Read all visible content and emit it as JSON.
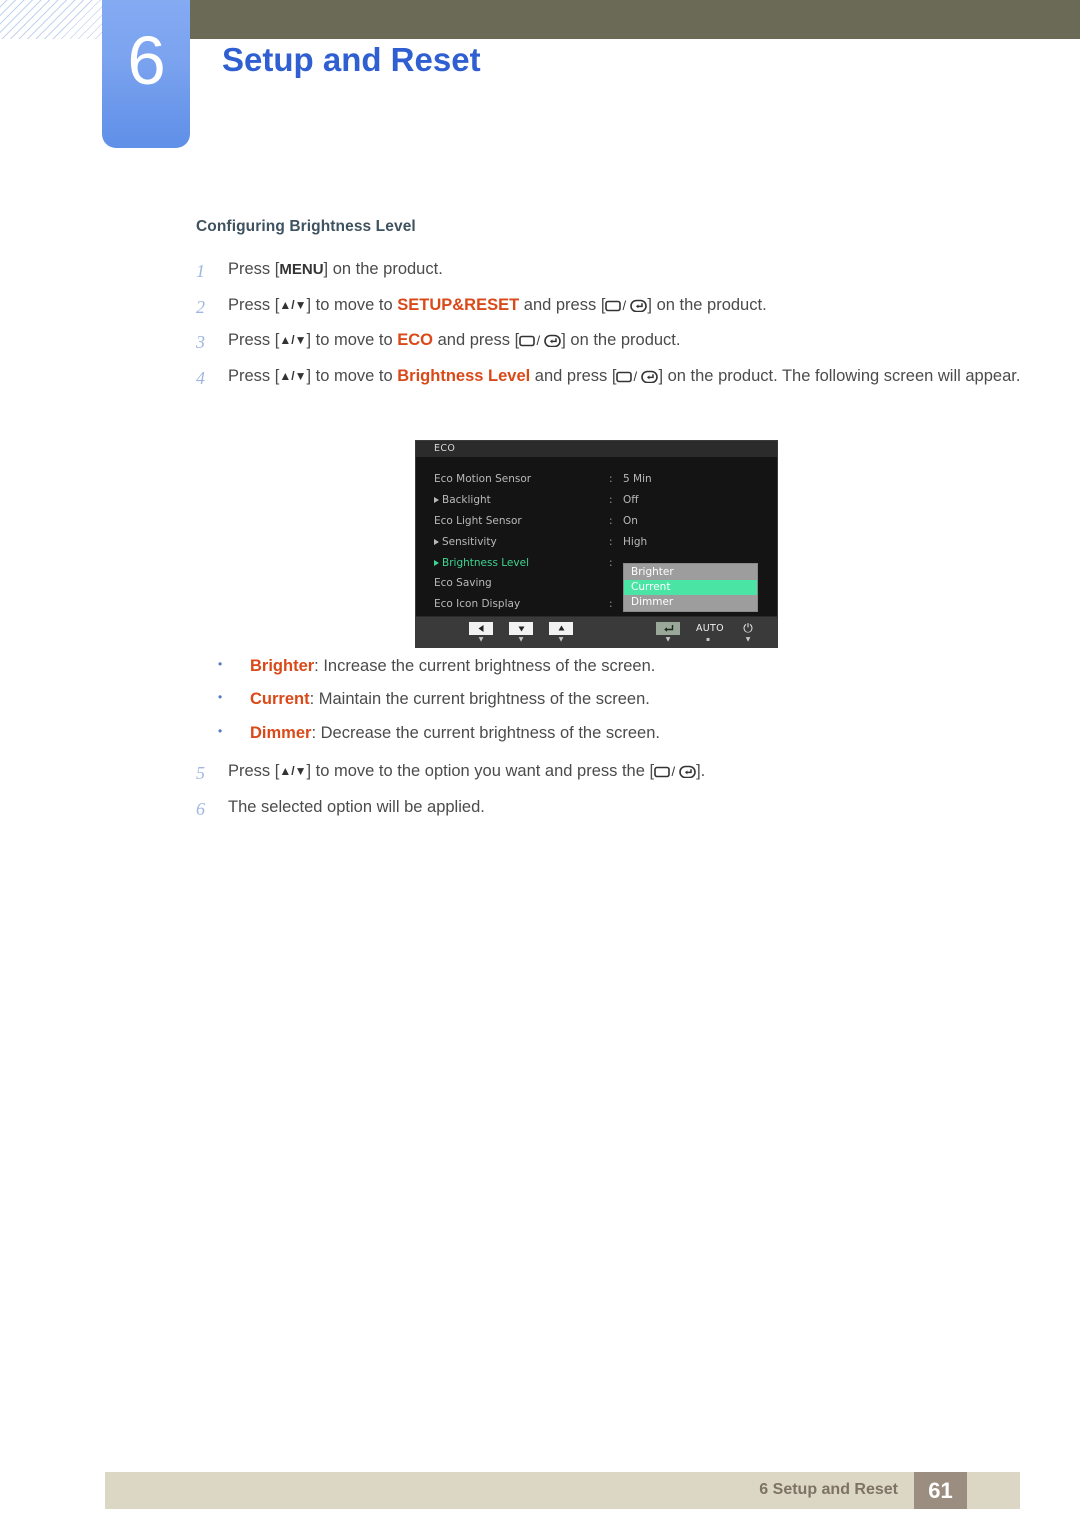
{
  "header": {
    "chapter_number": "6",
    "chapter_title": "Setup and Reset",
    "accent_color": "#2f5fd0",
    "badge_color": "#7ba3ef",
    "bar_color": "#6b6a56"
  },
  "section": {
    "heading": "Configuring Brightness Level"
  },
  "steps": [
    {
      "num": "1",
      "parts": [
        {
          "t": "text",
          "v": "Press ["
        },
        {
          "t": "menukey",
          "v": "MENU"
        },
        {
          "t": "text",
          "v": "] on the product."
        }
      ]
    },
    {
      "num": "2",
      "parts": [
        {
          "t": "text",
          "v": "Press ["
        },
        {
          "t": "arrows",
          "v": "▲/▼"
        },
        {
          "t": "text",
          "v": "] to move to "
        },
        {
          "t": "kw",
          "v": "SETUP&RESET"
        },
        {
          "t": "text",
          "v": " and press ["
        },
        {
          "t": "backenter",
          "v": "back/enter-key-icon"
        },
        {
          "t": "text",
          "v": "] on the product."
        }
      ]
    },
    {
      "num": "3",
      "parts": [
        {
          "t": "text",
          "v": "Press ["
        },
        {
          "t": "arrows",
          "v": "▲/▼"
        },
        {
          "t": "text",
          "v": "] to move to "
        },
        {
          "t": "kw",
          "v": "ECO"
        },
        {
          "t": "text",
          "v": " and press ["
        },
        {
          "t": "backenter",
          "v": "back/enter-key-icon"
        },
        {
          "t": "text",
          "v": "] on the product."
        }
      ]
    },
    {
      "num": "4",
      "parts": [
        {
          "t": "text",
          "v": "Press ["
        },
        {
          "t": "arrows",
          "v": "▲/▼"
        },
        {
          "t": "text",
          "v": "] to move to "
        },
        {
          "t": "kw",
          "v": "Brightness Level"
        },
        {
          "t": "text",
          "v": " and press ["
        },
        {
          "t": "backenter",
          "v": "back/enter-key-icon"
        },
        {
          "t": "text",
          "v": "] on the product. The following screen will appear."
        }
      ]
    }
  ],
  "steps_tail": [
    {
      "num": "5",
      "parts": [
        {
          "t": "text",
          "v": "Press ["
        },
        {
          "t": "arrows",
          "v": "▲/▼"
        },
        {
          "t": "text",
          "v": "] to move to the option you want and press the ["
        },
        {
          "t": "backenter",
          "v": "back/enter-key-icon"
        },
        {
          "t": "text",
          "v": "]."
        }
      ]
    },
    {
      "num": "6",
      "parts": [
        {
          "t": "text",
          "v": "The selected option will be applied."
        }
      ]
    }
  ],
  "osd": {
    "title": "ECO",
    "rows": [
      {
        "arrow": false,
        "label": "Eco Motion Sensor",
        "colon": ":",
        "value": "5 Min",
        "selected": false
      },
      {
        "arrow": true,
        "label": "Backlight",
        "colon": ":",
        "value": "Off",
        "selected": false
      },
      {
        "arrow": false,
        "label": "Eco Light Sensor",
        "colon": ":",
        "value": "On",
        "selected": false
      },
      {
        "arrow": true,
        "label": "Sensitivity",
        "colon": ":",
        "value": "High",
        "selected": false
      },
      {
        "arrow": true,
        "label": "Brightness Level",
        "colon": ":",
        "value": "",
        "selected": true
      },
      {
        "arrow": false,
        "label": "Eco Saving",
        "colon": "",
        "value": "",
        "selected": false
      },
      {
        "arrow": false,
        "label": "Eco Icon Display",
        "colon": ":",
        "value": "Off",
        "selected": false
      }
    ],
    "dropdown": {
      "options": [
        "Brighter",
        "Current",
        "Dimmer"
      ],
      "selected": "Current",
      "highlight_color": "#4ae5a4",
      "background_color": "#9d9d9d"
    },
    "keys": [
      {
        "name": "left-arrow-key",
        "glyph": "left",
        "sub": "▼"
      },
      {
        "name": "down-arrow-key",
        "glyph": "down",
        "sub": "▼"
      },
      {
        "name": "up-arrow-key",
        "glyph": "up",
        "sub": "▼"
      },
      {
        "name": "enter-key",
        "glyph": "enter",
        "sub": "▼"
      },
      {
        "name": "auto-key",
        "glyph": "text",
        "label": "AUTO",
        "sub": "▪"
      },
      {
        "name": "power-key",
        "glyph": "power",
        "label": "⏻",
        "sub": "▼"
      }
    ],
    "selected_row_color": "#3fd48f"
  },
  "bullets": [
    {
      "term": "Brighter",
      "desc": ": Increase the current brightness of the screen."
    },
    {
      "term": "Current",
      "desc": ": Maintain the current brightness of the screen."
    },
    {
      "term": "Dimmer",
      "desc": ": Decrease the current brightness of the screen."
    }
  ],
  "footer": {
    "text": "6 Setup and Reset",
    "page": "61",
    "bar_color": "#dcd7c4",
    "page_box_color": "#9b8d80"
  }
}
